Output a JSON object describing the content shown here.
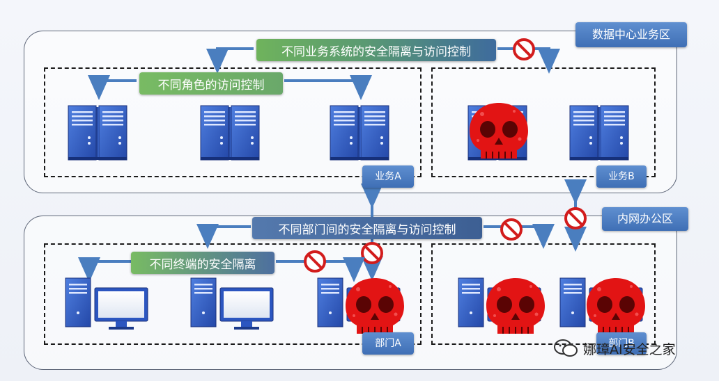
{
  "zones": {
    "datacenter": {
      "label": "数据中心业务区"
    },
    "office": {
      "label": "内网办公区"
    }
  },
  "groups": {
    "business_a": {
      "label": "业务A"
    },
    "business_b": {
      "label": "业务B"
    },
    "dept_a": {
      "label": "部门A"
    },
    "dept_b": {
      "label": "部门B"
    }
  },
  "policies": {
    "business_isolation": "不同业务系统的安全隔离与访问控制",
    "role_access": "不同角色的访问控制",
    "dept_isolation": "不同部门间的安全隔离与访问控制",
    "terminal_isolation": "不同终端的安全隔离"
  },
  "icons": {
    "server": "server-icon",
    "desktop": "desktop-computer-icon",
    "compromised": "red-skull-icon",
    "blocked": "prohibition-icon"
  },
  "colors": {
    "tag_blue": "#4a7bc0",
    "server_blue": "#2f5dbf",
    "skull_red": "#e01010",
    "block_red": "#d21c1c",
    "arrow_blue": "#4a7ebf"
  },
  "watermark": {
    "text": "娜璋AI安全之家"
  }
}
